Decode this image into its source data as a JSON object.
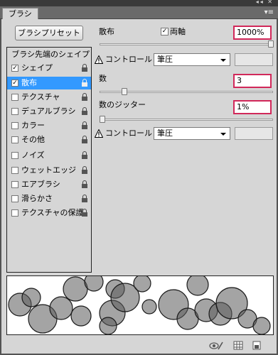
{
  "window": {
    "collapse_glyph": "◂◂",
    "close_glyph": "✕"
  },
  "tab": {
    "label": "ブラシ"
  },
  "panel_menu_glyph": "▾≡",
  "preset_button": {
    "label": "ブラシプリセット"
  },
  "categories": {
    "header": "ブラシ先端のシェイプ",
    "items": [
      {
        "label": "シェイプ",
        "checked": true,
        "selected": false
      },
      {
        "label": "散布",
        "checked": true,
        "selected": true
      },
      {
        "label": "テクスチャ",
        "checked": false,
        "selected": false
      },
      {
        "label": "デュアルブラシ",
        "checked": false,
        "selected": false
      },
      {
        "label": "カラー",
        "checked": false,
        "selected": false
      },
      {
        "label": "その他",
        "checked": false,
        "selected": false
      },
      {
        "label": "ノイズ",
        "checked": false,
        "selected": false
      },
      {
        "label": "ウェットエッジ",
        "checked": false,
        "selected": false
      },
      {
        "label": "エアブラシ",
        "checked": false,
        "selected": false
      },
      {
        "label": "滑らかさ",
        "checked": false,
        "selected": false
      },
      {
        "label": "テクスチャの保護",
        "checked": false,
        "selected": false
      }
    ]
  },
  "scatter": {
    "label": "散布",
    "both_axes": {
      "label": "両軸",
      "checked": true
    },
    "value": "1000%",
    "slider_level_percent": 100
  },
  "control1": {
    "label": "コントロール：",
    "value": "筆圧"
  },
  "count": {
    "label": "数",
    "value": "3",
    "slider_level_percent": 13
  },
  "count_jitter": {
    "label": "数のジッター",
    "value": "1%",
    "slider_level_percent": 1
  },
  "control2": {
    "label": "コントロール：",
    "value": "筆圧"
  },
  "icons": {
    "checkmark": "✓",
    "warning": "warning-icon",
    "lock": "lock-icon",
    "toggle_preview": "eye-brush-icon",
    "grid": "grid-icon",
    "new_preset": "new-preset-icon"
  }
}
